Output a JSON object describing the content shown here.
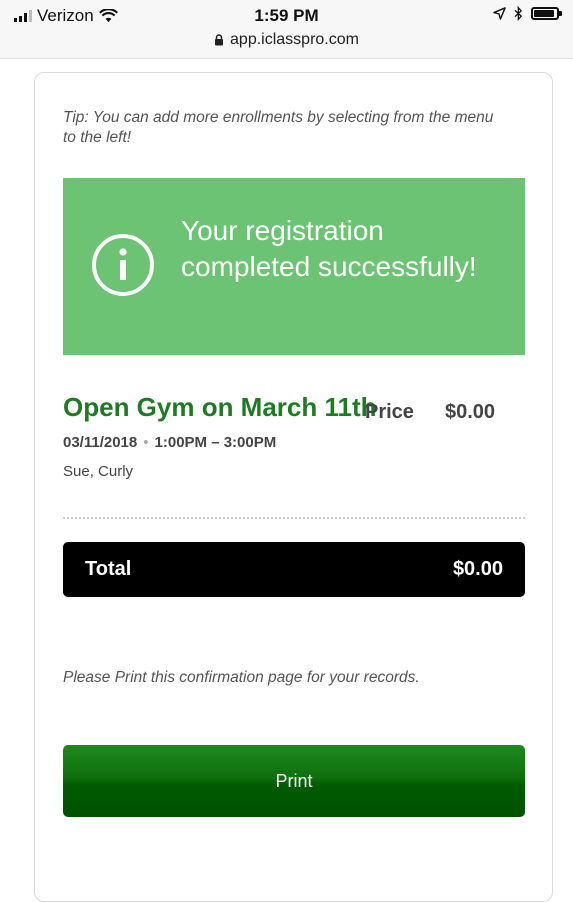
{
  "status_bar": {
    "carrier": "Verizon",
    "time": "1:59 PM",
    "url": "app.iclasspro.com"
  },
  "tip": "Tip: You can add more enrollments by selecting from the menu to the left!",
  "alert": {
    "message": "Your registration completed successfully!",
    "icon": "info-icon",
    "color": "#6dc374"
  },
  "enrollment": {
    "title": "Open Gym on March 11th",
    "price_label": "Price",
    "price": "$0.00",
    "date": "03/11/2018",
    "time": "1:00PM – 3:00PM",
    "students": "Sue, Curly"
  },
  "total": {
    "label": "Total",
    "value": "$0.00"
  },
  "print_note": "Please Print this confirmation page for your records.",
  "print_button": {
    "label": "Print",
    "color": "#0e6f0e"
  },
  "colors": {
    "title_green": "#1f7a25",
    "total_bar": "#000000"
  }
}
